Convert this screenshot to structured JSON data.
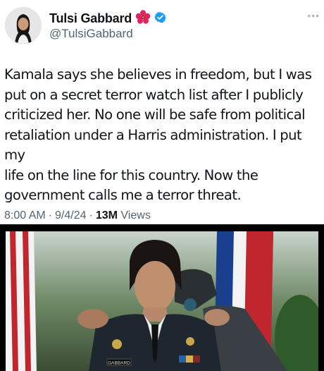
{
  "author": {
    "name": "Tulsi Gabbard",
    "name_emoji": "hibiscus-icon",
    "verified": "verified-badge-icon",
    "handle": "@TulsiGabbard"
  },
  "menu_icon": "more-icon",
  "tweet": {
    "lines": [
      "Kamala says she believes in freedom, but I was",
      "put on a secret terror watch list after I publicly",
      "criticized her. No one will be safe from political",
      "retaliation under a Harris administration. I put my",
      "life on the line for this country. Now the",
      "government calls me a terror threat."
    ],
    "time": "8:00 AM",
    "date": "9/4/24",
    "separator": "·",
    "views_count": "13M",
    "views_label": "Views"
  },
  "photo": {
    "name_tape": "GABBARD",
    "description_icon": "army-uniform-photo"
  },
  "colors": {
    "verified": "#1d9bf0",
    "meta_gray": "#536471",
    "text": "#0f1419",
    "uniform": "#1e2630"
  }
}
